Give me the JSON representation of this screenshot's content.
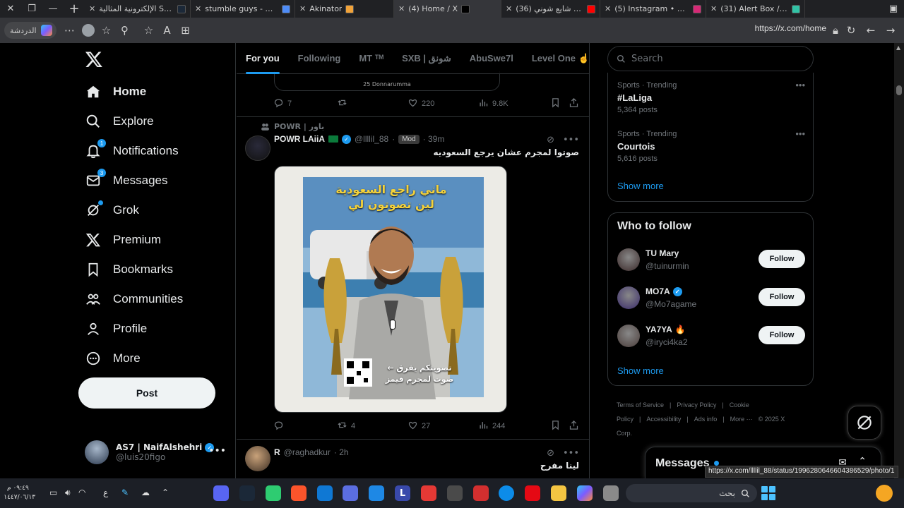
{
  "browser": {
    "tabs": [
      {
        "title": "الإلكترونية المثالية Steam",
        "color": "#1b2838"
      },
      {
        "title": "stumble guys - بحث",
        "color": "#4e8cf7"
      },
      {
        "title": "Akinator",
        "color": "#f1a33a"
      },
      {
        "title": "(4) Home / X",
        "color": "#000000",
        "active": true
      },
      {
        "title": "(36) شيله ابو شايع شوني",
        "color": "#ff0000"
      },
      {
        "title": "(5) Instagram • الرسائل",
        "color": "#d62976"
      },
      {
        "title": "(31) Alert Box / Stream",
        "color": "#32c3a6"
      }
    ],
    "copilot_label": "الدردشة",
    "url": "https://x.com/home",
    "status_url": "https://x.com/llllil_88/status/1996280646604386529/photo/1"
  },
  "nav": {
    "items": [
      {
        "label": "Home",
        "icon": "home-icon",
        "bold": true
      },
      {
        "label": "Explore",
        "icon": "search-icon"
      },
      {
        "label": "Notifications",
        "icon": "bell-icon",
        "badge": "1"
      },
      {
        "label": "Messages",
        "icon": "envelope-icon",
        "badge": "3"
      },
      {
        "label": "Grok",
        "icon": "grok-icon",
        "dot": true
      },
      {
        "label": "Premium",
        "icon": "x-logo-icon"
      },
      {
        "label": "Bookmarks",
        "icon": "bookmark-icon"
      },
      {
        "label": "Communities",
        "icon": "people-icon"
      },
      {
        "label": "Profile",
        "icon": "person-icon"
      },
      {
        "label": "More",
        "icon": "more-circle-icon"
      }
    ],
    "post_label": "Post",
    "account": {
      "name": "AS7 | NaifAlshehri",
      "handle": "@luis20figo"
    }
  },
  "feed": {
    "tabs": [
      "For you",
      "Following",
      "MT ᵀᴹ",
      "SXB | شونق",
      "AbuSwe7l",
      "Level One ☝"
    ],
    "active_tab": "For you",
    "prev_card_caption": "25 Donnarumma",
    "prev_actions": {
      "replies": "7",
      "reposts": "",
      "likes": "220",
      "views": "9.8K"
    },
    "tweet1": {
      "social_context": "POWR | باور",
      "name": "POWR LAiiA",
      "handle": "@llllil_88",
      "mod_tag": "Mod",
      "time": "· 39m",
      "text": "صوتوا لمجرم عشان يرجع السعوديه",
      "image_heading_line1": "ماني راجع السعودية",
      "image_heading_line2": "لين تصوتون لي",
      "image_footer_line1": "تصويتكم يفرق ←",
      "image_footer_line2": "صوت لمجرم قيمز",
      "actions": {
        "replies": "",
        "reposts": "4",
        "likes": "27",
        "views": "244"
      }
    },
    "tweet2": {
      "name": "R",
      "handle": "@raghadkur",
      "time": "· 2h",
      "text": "لينا   مفرح"
    }
  },
  "right": {
    "search_placeholder": "Search",
    "trends": [
      {
        "meta": "Sports · Trending",
        "name": "#LaLiga",
        "count": "5,364 posts"
      },
      {
        "meta": "Sports · Trending",
        "name": "Courtois",
        "count": "5,616 posts"
      }
    ],
    "trends_show_more": "Show more",
    "who_to_follow_title": "Who to follow",
    "follow": [
      {
        "name": "TU Mary",
        "handle": "@tuinurmin",
        "verified": false,
        "emoji": "",
        "color": "#3b2a2a"
      },
      {
        "name": "MO7A",
        "handle": "@Mo7agame",
        "verified": true,
        "emoji": "",
        "color": "#3a2c6b"
      },
      {
        "name": "YA7YA",
        "handle": "@iryci4ka2",
        "verified": false,
        "emoji": "🔥",
        "color": "#4a3d3a"
      }
    ],
    "follow_label": "Follow",
    "follow_show_more": "Show more",
    "footer_links": [
      "Terms of Service",
      "|",
      "Privacy Policy",
      "|",
      "Cookie Policy",
      "|",
      "Accessibility",
      "|",
      "Ads info",
      "|",
      "More ···",
      "© 2025 X Corp."
    ],
    "messages_title": "Messages"
  },
  "taskbar": {
    "time": "٠٩:٤٩ م",
    "date": "١٤٤٧/٠٦/١٣",
    "lang": "ع",
    "search_text": "بحث"
  }
}
